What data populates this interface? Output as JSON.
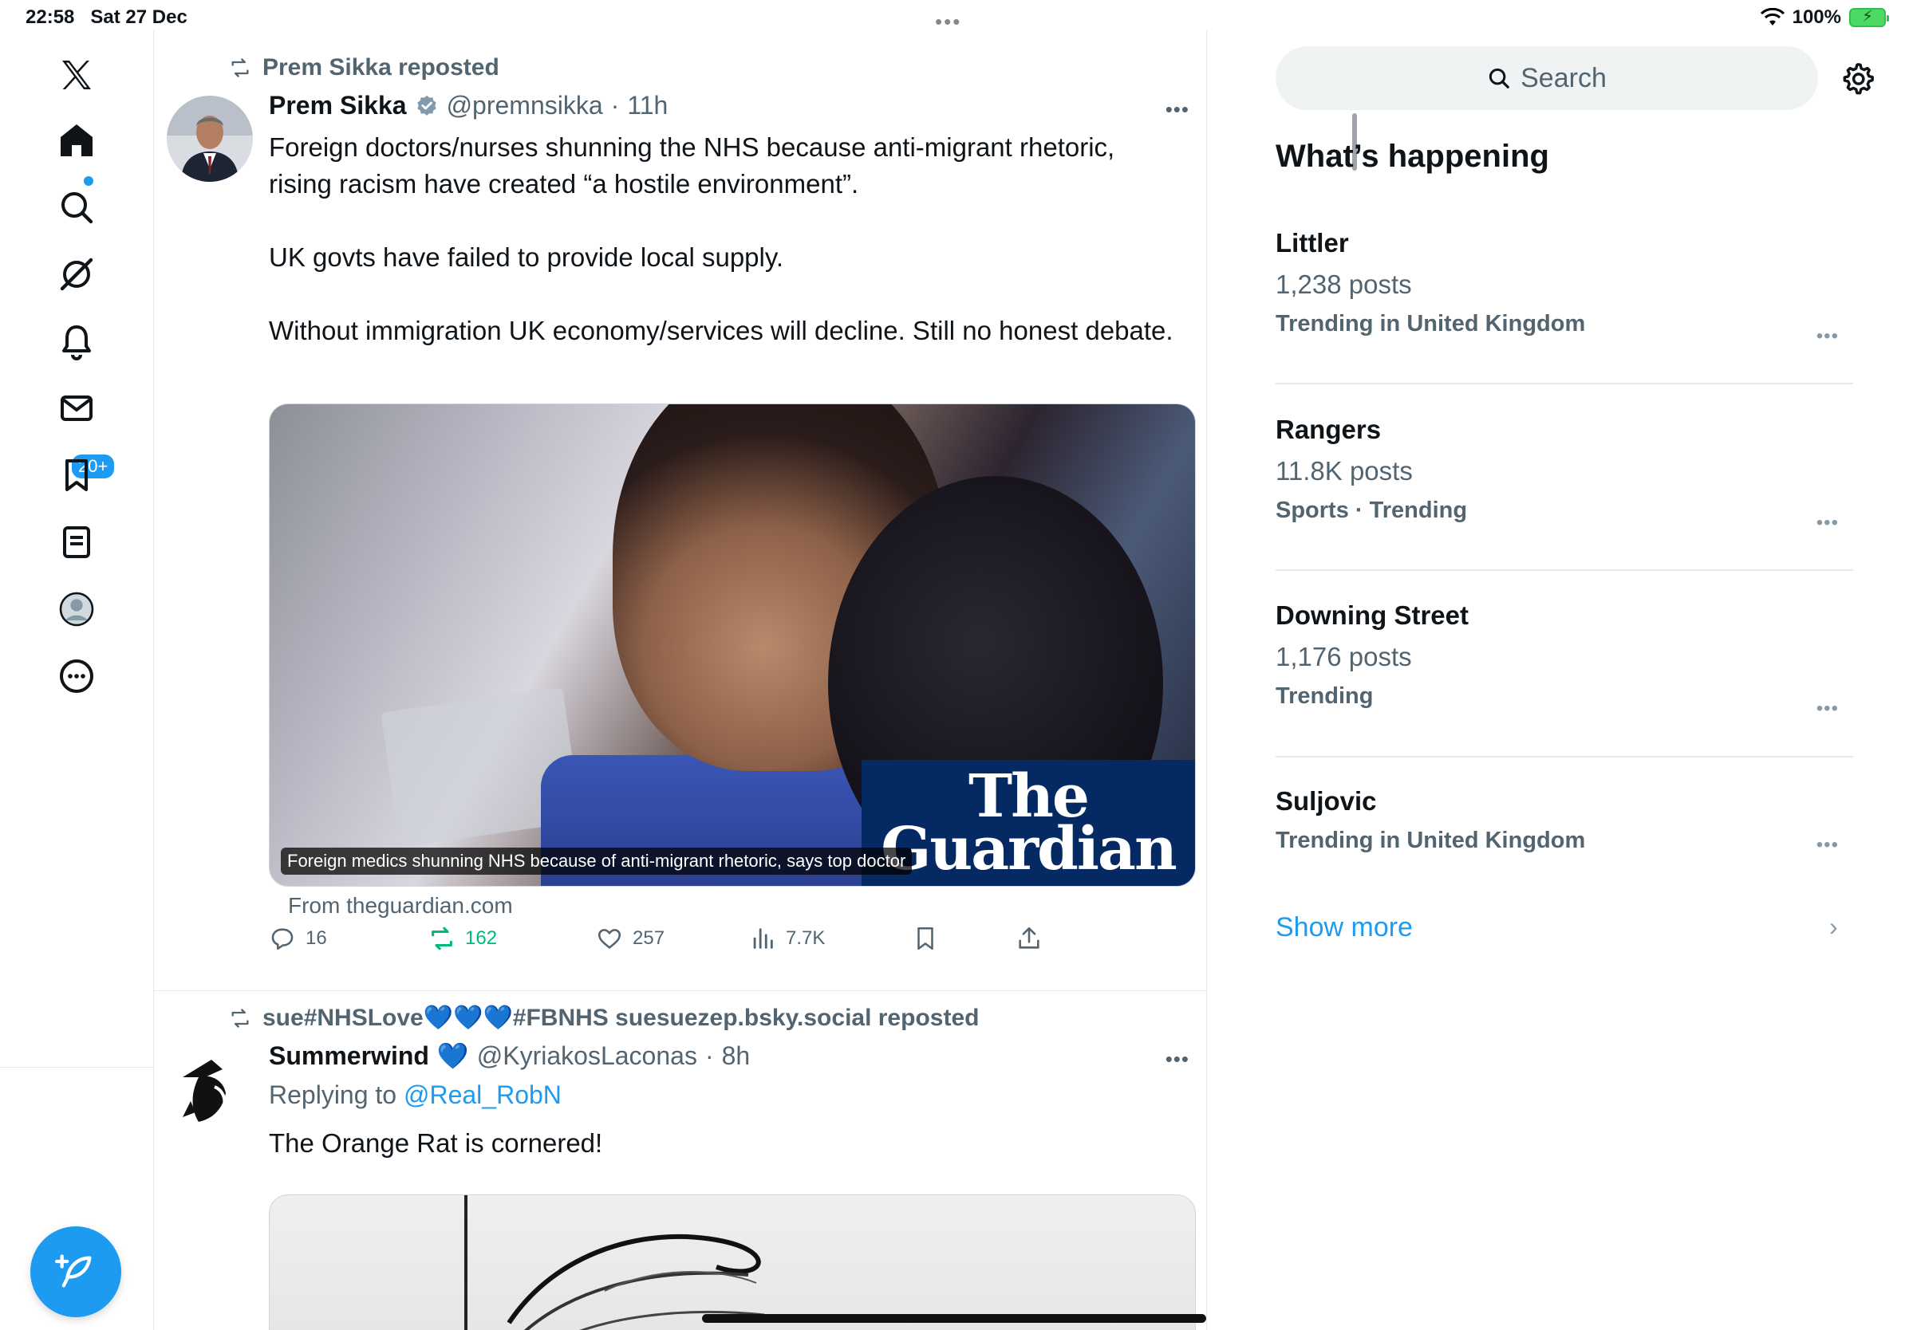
{
  "status_bar": {
    "time": "22:58",
    "date": "Sat 27 Dec",
    "battery": "100%"
  },
  "nav": {
    "notifications_badge": "20+",
    "icons": [
      "x-logo-icon",
      "home-icon",
      "search-icon",
      "grok-icon",
      "notifications-icon",
      "messages-icon",
      "bookmarks-icon",
      "lists-icon",
      "profile-icon",
      "more-icon"
    ]
  },
  "tweets": [
    {
      "repost_label": "Prem Sikka reposted",
      "author_name": "Prem Sikka",
      "author_handle": "@premnsikka",
      "time": "11h",
      "text": [
        "Foreign doctors/nurses shunning the NHS because anti-migrant rhetoric, rising racism have created “a hostile environment”.",
        "UK govts have failed to provide local supply.",
        "Without immigration UK economy/services will decline. Still no honest debate."
      ],
      "card": {
        "caption": "Foreign medics shunning NHS because of anti-migrant rhetoric, says top doctor",
        "logo_line1": "The",
        "logo_line2": "Guardian",
        "source": "From theguardian.com"
      },
      "stats": {
        "replies": "16",
        "reposts": "162",
        "likes": "257",
        "views": "7.7K"
      }
    },
    {
      "repost_label": "sue#NHSLove💙💙💙#FBNHS suesuezep.bsky.social reposted",
      "author_name": "Summerwind",
      "author_emoji": "💙",
      "author_handle": "@KyriakosLaconas",
      "time": "8h",
      "replying_prefix": "Replying to",
      "replying_to": "@Real_RobN",
      "text": [
        "The Orange Rat is cornered!"
      ]
    }
  ],
  "sidebar": {
    "search_placeholder": "Search",
    "section_title": "What’s happening",
    "trends": [
      {
        "name": "Littler",
        "posts": "1,238 posts",
        "context": "Trending in United Kingdom"
      },
      {
        "name": "Rangers",
        "posts": "11.8K posts",
        "context": "Sports · Trending"
      },
      {
        "name": "Downing Street",
        "posts": "1,176 posts",
        "context": "Trending"
      },
      {
        "name": "Suljovic",
        "posts": "",
        "context": "Trending in United Kingdom"
      }
    ],
    "show_more": "Show more"
  },
  "colors": {
    "accent": "#1d9bf0",
    "repost_green": "#00ba7c",
    "guardian_blue": "#052962",
    "muted": "#536471"
  }
}
